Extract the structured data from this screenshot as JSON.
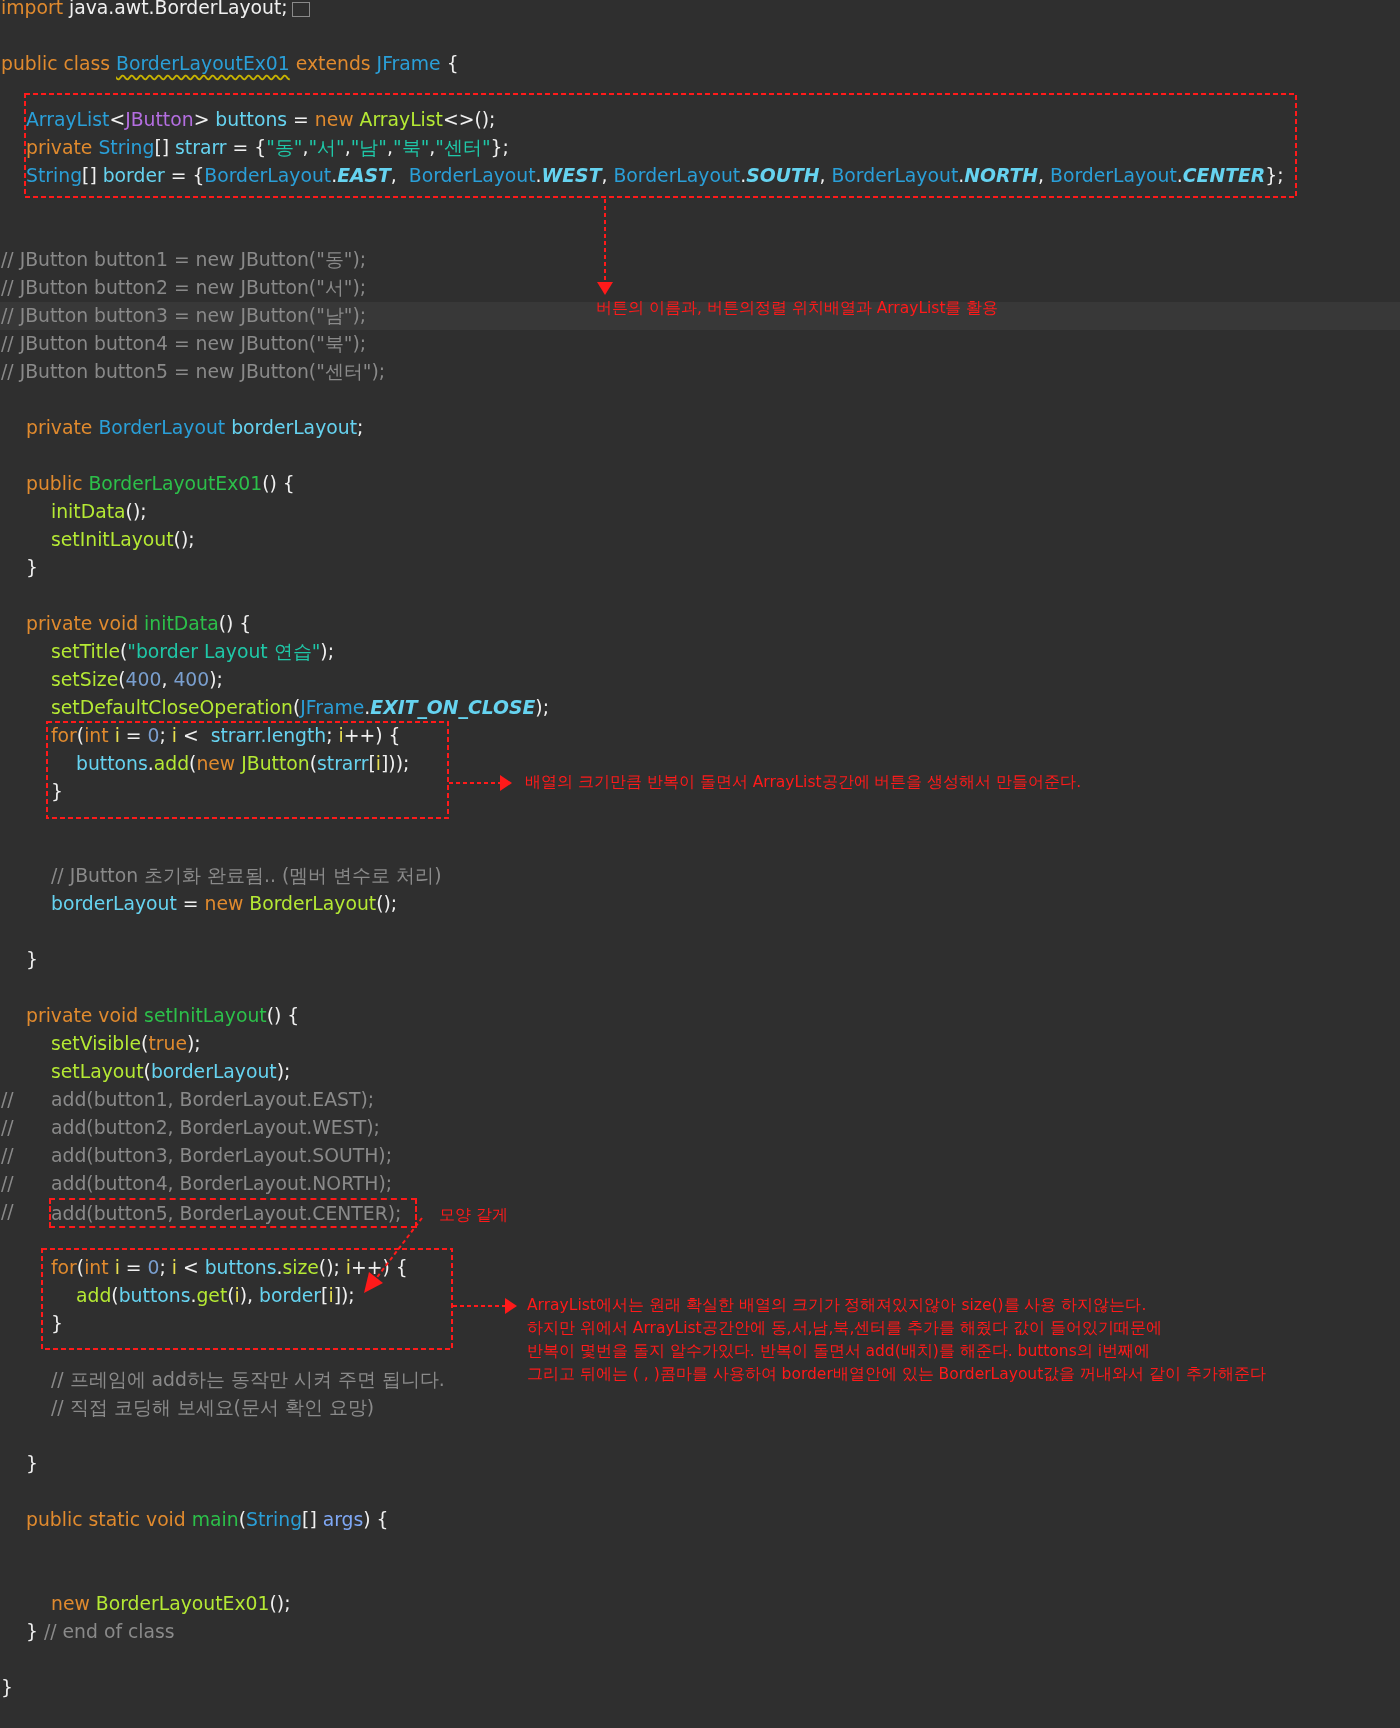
{
  "editor": {
    "lines": [
      {
        "current": false,
        "folded": true,
        "tokens": [
          {
            "text": "import ",
            "kind": "kw"
          },
          {
            "text": "java.awt.BorderLayout;",
            "kind": "pl"
          }
        ]
      },
      {
        "current": false
      },
      {
        "current": false,
        "tokens": [
          {
            "text": "public class ",
            "kind": "kw"
          },
          {
            "text": "BorderLayoutEx01",
            "kind": "type",
            "warning": true
          },
          {
            "text": " extends ",
            "kind": "kw"
          },
          {
            "text": "JFrame",
            "kind": "type"
          },
          {
            "text": " {",
            "kind": "pl"
          }
        ]
      },
      {
        "current": false
      },
      {
        "current": false,
        "tokens": [
          {
            "text": "\tArrayList",
            "kind": "type"
          },
          {
            "text": "<",
            "kind": "pl"
          },
          {
            "text": "JButton",
            "kind": "gen"
          },
          {
            "text": "> ",
            "kind": "pl"
          },
          {
            "text": "buttons",
            "kind": "fld"
          },
          {
            "text": " = ",
            "kind": "pl"
          },
          {
            "text": "new ",
            "kind": "kw"
          },
          {
            "text": "ArrayList",
            "kind": "call"
          },
          {
            "text": "<>();",
            "kind": "pl"
          }
        ]
      },
      {
        "current": false,
        "tokens": [
          {
            "text": "\tprivate ",
            "kind": "kw"
          },
          {
            "text": "String",
            "kind": "type"
          },
          {
            "text": "[] ",
            "kind": "pl"
          },
          {
            "text": "strarr",
            "kind": "fld"
          },
          {
            "text": " = {",
            "kind": "pl"
          },
          {
            "text": "\"동\"",
            "kind": "str"
          },
          {
            "text": ",",
            "kind": "pl"
          },
          {
            "text": "\"서\"",
            "kind": "str"
          },
          {
            "text": ",",
            "kind": "pl"
          },
          {
            "text": "\"남\"",
            "kind": "str"
          },
          {
            "text": ",",
            "kind": "pl"
          },
          {
            "text": "\"북\"",
            "kind": "str"
          },
          {
            "text": ",",
            "kind": "pl"
          },
          {
            "text": "\"센터\"",
            "kind": "str"
          },
          {
            "text": "};",
            "kind": "pl"
          }
        ]
      },
      {
        "current": false,
        "tokens": [
          {
            "text": "\tString",
            "kind": "type"
          },
          {
            "text": "[] ",
            "kind": "pl"
          },
          {
            "text": "border",
            "kind": "fld"
          },
          {
            "text": " = {",
            "kind": "pl"
          },
          {
            "text": "BorderLayout",
            "kind": "type"
          },
          {
            "text": ".",
            "kind": "pl"
          },
          {
            "text": "EAST",
            "kind": "const"
          },
          {
            "text": ",  ",
            "kind": "pl"
          },
          {
            "text": "BorderLayout",
            "kind": "type"
          },
          {
            "text": ".",
            "kind": "pl"
          },
          {
            "text": "WEST",
            "kind": "const"
          },
          {
            "text": ", ",
            "kind": "pl"
          },
          {
            "text": "BorderLayout",
            "kind": "type"
          },
          {
            "text": ".",
            "kind": "pl"
          },
          {
            "text": "SOUTH",
            "kind": "const"
          },
          {
            "text": ", ",
            "kind": "pl"
          },
          {
            "text": "BorderLayout",
            "kind": "type"
          },
          {
            "text": ".",
            "kind": "pl"
          },
          {
            "text": "NORTH",
            "kind": "const"
          },
          {
            "text": ", ",
            "kind": "pl"
          },
          {
            "text": "BorderLayout",
            "kind": "type"
          },
          {
            "text": ".",
            "kind": "pl"
          },
          {
            "text": "CENTER",
            "kind": "const"
          },
          {
            "text": "};",
            "kind": "pl"
          }
        ]
      },
      {
        "current": false
      },
      {
        "current": false
      },
      {
        "current": false,
        "tokens": [
          {
            "text": "// JButton button1 = new JButton(\"동\");",
            "kind": "cmt"
          }
        ]
      },
      {
        "current": false,
        "tokens": [
          {
            "text": "// JButton button2 = new JButton(\"서\");",
            "kind": "cmt"
          }
        ]
      },
      {
        "current": true,
        "tokens": [
          {
            "text": "// JButton button3 = new JButton(\"남\");",
            "kind": "cmt"
          }
        ]
      },
      {
        "current": false,
        "tokens": [
          {
            "text": "// JButton button4 = new JButton(\"북\");",
            "kind": "cmt"
          }
        ]
      },
      {
        "current": false,
        "tokens": [
          {
            "text": "// JButton button5 = new JButton(\"센터\");",
            "kind": "cmt"
          }
        ]
      },
      {
        "current": false
      },
      {
        "current": false,
        "tokens": [
          {
            "text": "\tprivate ",
            "kind": "kw"
          },
          {
            "text": "BorderLayout ",
            "kind": "type"
          },
          {
            "text": "borderLayout",
            "kind": "fld"
          },
          {
            "text": ";",
            "kind": "pl"
          }
        ]
      },
      {
        "current": false
      },
      {
        "current": false,
        "tokens": [
          {
            "text": "\tpublic ",
            "kind": "kw"
          },
          {
            "text": "BorderLayoutEx01",
            "kind": "decl"
          },
          {
            "text": "() {",
            "kind": "pl"
          }
        ]
      },
      {
        "current": false,
        "tokens": [
          {
            "text": "\t\tinitData",
            "kind": "call"
          },
          {
            "text": "();",
            "kind": "pl"
          }
        ]
      },
      {
        "current": false,
        "tokens": [
          {
            "text": "\t\tsetInitLayout",
            "kind": "call"
          },
          {
            "text": "();",
            "kind": "pl"
          }
        ]
      },
      {
        "current": false,
        "tokens": [
          {
            "text": "\t}",
            "kind": "pl"
          }
        ]
      },
      {
        "current": false
      },
      {
        "current": false,
        "tokens": [
          {
            "text": "\tprivate void ",
            "kind": "kw"
          },
          {
            "text": "initData",
            "kind": "decl"
          },
          {
            "text": "() {",
            "kind": "pl"
          }
        ]
      },
      {
        "current": false,
        "tokens": [
          {
            "text": "\t\tsetTitle",
            "kind": "call"
          },
          {
            "text": "(",
            "kind": "pl"
          },
          {
            "text": "\"border Layout 연습\"",
            "kind": "str"
          },
          {
            "text": ");",
            "kind": "pl"
          }
        ]
      },
      {
        "current": false,
        "tokens": [
          {
            "text": "\t\tsetSize",
            "kind": "call"
          },
          {
            "text": "(",
            "kind": "pl"
          },
          {
            "text": "400",
            "kind": "num"
          },
          {
            "text": ", ",
            "kind": "pl"
          },
          {
            "text": "400",
            "kind": "num"
          },
          {
            "text": ");",
            "kind": "pl"
          }
        ]
      },
      {
        "current": false,
        "tokens": [
          {
            "text": "\t\tsetDefaultCloseOperation",
            "kind": "call"
          },
          {
            "text": "(",
            "kind": "pl"
          },
          {
            "text": "JFrame",
            "kind": "type"
          },
          {
            "text": ".",
            "kind": "pl"
          },
          {
            "text": "EXIT_ON_CLOSE",
            "kind": "const"
          },
          {
            "text": ");",
            "kind": "pl"
          }
        ]
      },
      {
        "current": false,
        "tokens": [
          {
            "text": "\t\tfor",
            "kind": "kw"
          },
          {
            "text": "(",
            "kind": "pl"
          },
          {
            "text": "int ",
            "kind": "kw"
          },
          {
            "text": "i",
            "kind": "loc"
          },
          {
            "text": " = ",
            "kind": "pl"
          },
          {
            "text": "0",
            "kind": "num"
          },
          {
            "text": "; ",
            "kind": "pl"
          },
          {
            "text": "i",
            "kind": "loc"
          },
          {
            "text": " <  ",
            "kind": "pl"
          },
          {
            "text": "strarr.length",
            "kind": "fld"
          },
          {
            "text": "; ",
            "kind": "pl"
          },
          {
            "text": "i",
            "kind": "loc"
          },
          {
            "text": "++) {",
            "kind": "pl"
          }
        ]
      },
      {
        "current": false,
        "tokens": [
          {
            "text": "\t\t\tbuttons",
            "kind": "fld"
          },
          {
            "text": ".",
            "kind": "pl"
          },
          {
            "text": "add",
            "kind": "call"
          },
          {
            "text": "(",
            "kind": "pl"
          },
          {
            "text": "new ",
            "kind": "kw"
          },
          {
            "text": "JButton",
            "kind": "call"
          },
          {
            "text": "(",
            "kind": "pl"
          },
          {
            "text": "strarr",
            "kind": "fld"
          },
          {
            "text": "[",
            "kind": "pl"
          },
          {
            "text": "i",
            "kind": "loc"
          },
          {
            "text": "]));",
            "kind": "pl"
          }
        ]
      },
      {
        "current": false,
        "tokens": [
          {
            "text": "\t\t}",
            "kind": "pl"
          }
        ]
      },
      {
        "current": false
      },
      {
        "current": false
      },
      {
        "current": false,
        "tokens": [
          {
            "text": "\t\t// JButton 초기화 완료됨.. (멤버 변수로 처리)",
            "kind": "cmt"
          }
        ]
      },
      {
        "current": false,
        "tokens": [
          {
            "text": "\t\tborderLayout",
            "kind": "fld"
          },
          {
            "text": " = ",
            "kind": "pl"
          },
          {
            "text": "new ",
            "kind": "kw"
          },
          {
            "text": "BorderLayout",
            "kind": "call"
          },
          {
            "text": "();",
            "kind": "pl"
          }
        ]
      },
      {
        "current": false
      },
      {
        "current": false,
        "tokens": [
          {
            "text": "\t}",
            "kind": "pl"
          }
        ]
      },
      {
        "current": false
      },
      {
        "current": false,
        "tokens": [
          {
            "text": "\tprivate void ",
            "kind": "kw"
          },
          {
            "text": "setInitLayout",
            "kind": "decl"
          },
          {
            "text": "() {",
            "kind": "pl"
          }
        ]
      },
      {
        "current": false,
        "tokens": [
          {
            "text": "\t\tsetVisible",
            "kind": "call"
          },
          {
            "text": "(",
            "kind": "pl"
          },
          {
            "text": "true",
            "kind": "kw"
          },
          {
            "text": ");",
            "kind": "pl"
          }
        ]
      },
      {
        "current": false,
        "tokens": [
          {
            "text": "\t\tsetLayout",
            "kind": "call"
          },
          {
            "text": "(",
            "kind": "pl"
          },
          {
            "text": "borderLayout",
            "kind": "fld"
          },
          {
            "text": ");",
            "kind": "pl"
          }
        ]
      },
      {
        "current": false,
        "tokens": [
          {
            "text": "//\t\tadd(button1, BorderLayout.EAST);",
            "kind": "cmt"
          }
        ]
      },
      {
        "current": false,
        "tokens": [
          {
            "text": "//\t\tadd(button2, BorderLayout.WEST);",
            "kind": "cmt"
          }
        ]
      },
      {
        "current": false,
        "tokens": [
          {
            "text": "//\t\tadd(button3, BorderLayout.SOUTH);",
            "kind": "cmt"
          }
        ]
      },
      {
        "current": false,
        "tokens": [
          {
            "text": "//\t\tadd(button4, BorderLayout.NORTH);",
            "kind": "cmt"
          }
        ]
      },
      {
        "current": false,
        "tokens": [
          {
            "text": "//\t\t",
            "kind": "cmt"
          },
          {
            "text": "add(button5, BorderLayout.CENTER);",
            "kind": "cmt",
            "annotated": true
          }
        ]
      },
      {
        "current": false
      },
      {
        "current": false,
        "tokens": [
          {
            "text": "\t\tfor",
            "kind": "kw"
          },
          {
            "text": "(",
            "kind": "pl"
          },
          {
            "text": "int ",
            "kind": "kw"
          },
          {
            "text": "i",
            "kind": "loc"
          },
          {
            "text": " = ",
            "kind": "pl"
          },
          {
            "text": "0",
            "kind": "num"
          },
          {
            "text": "; ",
            "kind": "pl"
          },
          {
            "text": "i",
            "kind": "loc"
          },
          {
            "text": " < ",
            "kind": "pl"
          },
          {
            "text": "buttons",
            "kind": "fld"
          },
          {
            "text": ".",
            "kind": "pl"
          },
          {
            "text": "size",
            "kind": "call"
          },
          {
            "text": "(); ",
            "kind": "pl"
          },
          {
            "text": "i",
            "kind": "loc"
          },
          {
            "text": "++) {",
            "kind": "pl"
          }
        ]
      },
      {
        "current": false,
        "tokens": [
          {
            "text": "\t\t\tadd",
            "kind": "call"
          },
          {
            "text": "(",
            "kind": "pl"
          },
          {
            "text": "buttons",
            "kind": "fld"
          },
          {
            "text": ".",
            "kind": "pl"
          },
          {
            "text": "get",
            "kind": "call"
          },
          {
            "text": "(",
            "kind": "pl"
          },
          {
            "text": "i",
            "kind": "loc"
          },
          {
            "text": "), ",
            "kind": "pl"
          },
          {
            "text": "border",
            "kind": "fld"
          },
          {
            "text": "[",
            "kind": "pl"
          },
          {
            "text": "i",
            "kind": "loc"
          },
          {
            "text": "]);",
            "kind": "pl"
          }
        ]
      },
      {
        "current": false,
        "tokens": [
          {
            "text": "\t\t}",
            "kind": "pl"
          }
        ]
      },
      {
        "current": false
      },
      {
        "current": false,
        "tokens": [
          {
            "text": "\t\t// 프레임에 add하는 동작만 시켜 주면 됩니다.",
            "kind": "cmt"
          }
        ]
      },
      {
        "current": false,
        "tokens": [
          {
            "text": "\t\t// 직접 코딩해 보세요(문서 확인 요망)",
            "kind": "cmt"
          }
        ]
      },
      {
        "current": false
      },
      {
        "current": false,
        "tokens": [
          {
            "text": "\t}",
            "kind": "pl"
          }
        ]
      },
      {
        "current": false
      },
      {
        "current": false,
        "tokens": [
          {
            "text": "\tpublic static void ",
            "kind": "kw"
          },
          {
            "text": "main",
            "kind": "decl"
          },
          {
            "text": "(",
            "kind": "pl"
          },
          {
            "text": "String",
            "kind": "type"
          },
          {
            "text": "[] ",
            "kind": "pl"
          },
          {
            "text": "args",
            "kind": "par"
          },
          {
            "text": ") {",
            "kind": "pl"
          }
        ]
      },
      {
        "current": false
      },
      {
        "current": false
      },
      {
        "current": false,
        "tokens": [
          {
            "text": "\t\tnew ",
            "kind": "kw"
          },
          {
            "text": "BorderLayoutEx01",
            "kind": "call"
          },
          {
            "text": "();",
            "kind": "pl"
          }
        ]
      },
      {
        "current": false,
        "tokens": [
          {
            "text": "\t} ",
            "kind": "pl"
          },
          {
            "text": "// end of class",
            "kind": "cmt"
          }
        ]
      },
      {
        "current": false
      },
      {
        "current": false,
        "tokens": [
          {
            "text": "}",
            "kind": "pl"
          }
        ]
      }
    ]
  },
  "annotations": [
    {
      "lines": [
        "버튼의 이름과, 버튼의정렬 위치배열과 ArrayList를 활용"
      ]
    },
    {
      "lines": [
        "배열의 크기만큼 반복이 돌면서 ArrayList공간에 버튼을 생성해서 만들어준다."
      ]
    },
    {
      "lines": [
        "모양 같게"
      ]
    },
    {
      "lines": [
        "ArrayList에서는 원래 확실한 배열의 크기가 정해져있지않아 size()를 사용 하지않는다.",
        "하지만 위에서 ArrayList공간안에 동,서,남,북,센터를 추가를 해줬다 값이 들어있기때문에",
        "반복이 몇번을 돌지 알수가있다. 반복이 돌면서 add(배치)를 해준다. buttons의 i번째에",
        "그리고 뒤에는 ( , )콤마를 사용하여 border배열안에 있는 BorderLayout값을 꺼내와서 같이 추가해준다"
      ]
    }
  ]
}
